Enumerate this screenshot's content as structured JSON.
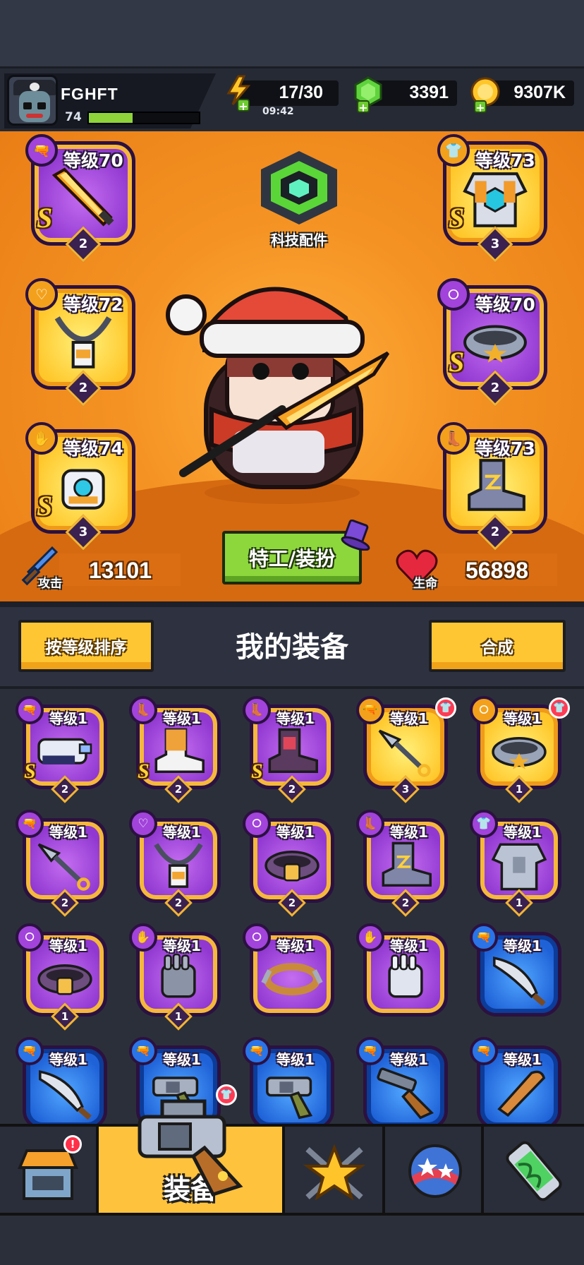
{
  "player": {
    "name": "FGHFT",
    "level": "74",
    "xp_fraction": 0.4
  },
  "resources": {
    "energy": {
      "value": "17/30",
      "timer": "09:42"
    },
    "gems": {
      "value": "3391"
    },
    "coins": {
      "value": "9307K"
    }
  },
  "hero": {
    "tech_parts_label": "科技配件",
    "costume_button": "特工/装扮",
    "attack": {
      "label": "攻击",
      "value": "13101"
    },
    "health": {
      "label": "生命",
      "value": "56898"
    },
    "equipped": {
      "weapon": {
        "level": "等级70",
        "stars": "2",
        "rank": "S",
        "rarity": "purple",
        "icon": "weapon-slot-icon"
      },
      "necklace": {
        "level": "等级72",
        "stars": "2",
        "rank": "",
        "rarity": "gold",
        "icon": "necklace-slot-icon"
      },
      "glove": {
        "level": "等级74",
        "stars": "3",
        "rank": "S",
        "rarity": "gold",
        "icon": "glove-slot-icon"
      },
      "armor": {
        "level": "等级73",
        "stars": "3",
        "rank": "S",
        "rarity": "gold",
        "icon": "armor-slot-icon"
      },
      "belt": {
        "level": "等级70",
        "stars": "2",
        "rank": "S",
        "rarity": "purple",
        "icon": "belt-slot-icon"
      },
      "boots": {
        "level": "等级73",
        "stars": "2",
        "rank": "",
        "rarity": "gold",
        "icon": "boots-slot-icon"
      }
    }
  },
  "inventory": {
    "sort_button": "按等级排序",
    "title": "我的装备",
    "merge_button": "合成",
    "items": [
      {
        "level": "等级1",
        "stars": "2",
        "rank": "S",
        "rarity": "purple",
        "type": "weapon",
        "item": "gun"
      },
      {
        "level": "等级1",
        "stars": "2",
        "rank": "S",
        "rarity": "purple",
        "type": "boots",
        "item": "boot"
      },
      {
        "level": "等级1",
        "stars": "2",
        "rank": "S",
        "rarity": "purple",
        "type": "boots",
        "item": "boot-dark"
      },
      {
        "level": "等级1",
        "stars": "3",
        "rank": "",
        "rarity": "gold",
        "type": "weapon",
        "item": "kunai",
        "new": true
      },
      {
        "level": "等级1",
        "stars": "1",
        "rank": "",
        "rarity": "gold",
        "type": "belt",
        "item": "belt",
        "new": true
      },
      {
        "level": "等级1",
        "stars": "2",
        "rank": "",
        "rarity": "purple",
        "type": "weapon",
        "item": "kunai"
      },
      {
        "level": "等级1",
        "stars": "2",
        "rank": "",
        "rarity": "purple",
        "type": "necklace",
        "item": "necklace"
      },
      {
        "level": "等级1",
        "stars": "2",
        "rank": "",
        "rarity": "purple",
        "type": "belt",
        "item": "belt-dark"
      },
      {
        "level": "等级1",
        "stars": "2",
        "rank": "",
        "rarity": "purple",
        "type": "boots",
        "item": "boot-purple"
      },
      {
        "level": "等级1",
        "stars": "1",
        "rank": "",
        "rarity": "purple",
        "type": "armor",
        "item": "armor"
      },
      {
        "level": "等级1",
        "stars": "1",
        "rank": "",
        "rarity": "purple",
        "type": "belt",
        "item": "belt-dark"
      },
      {
        "level": "等级1",
        "stars": "1",
        "rank": "",
        "rarity": "purple",
        "type": "glove",
        "item": "glove"
      },
      {
        "level": "等级1",
        "stars": "",
        "rank": "",
        "rarity": "purple",
        "type": "belt",
        "item": "belt-rope"
      },
      {
        "level": "等级1",
        "stars": "",
        "rank": "",
        "rarity": "purple",
        "type": "glove",
        "item": "glove-light"
      },
      {
        "level": "等级1",
        "stars": "",
        "rank": "",
        "rarity": "blue",
        "type": "weapon",
        "item": "machete"
      },
      {
        "level": "等级1",
        "stars": "",
        "rank": "",
        "rarity": "blue",
        "type": "weapon",
        "item": "machete"
      },
      {
        "level": "等级1",
        "stars": "",
        "rank": "",
        "rarity": "blue",
        "type": "weapon",
        "item": "revolver"
      },
      {
        "level": "等级1",
        "stars": "",
        "rank": "",
        "rarity": "blue",
        "type": "weapon",
        "item": "revolver"
      },
      {
        "level": "等级1",
        "stars": "",
        "rank": "",
        "rarity": "blue",
        "type": "weapon",
        "item": "shotgun"
      },
      {
        "level": "等级1",
        "stars": "",
        "rank": "",
        "rarity": "blue",
        "type": "weapon",
        "item": "bat"
      }
    ]
  },
  "nav": {
    "equipment_label": "装备",
    "shop_alert": "!",
    "tabs": [
      "shop-tab",
      "equipment-tab",
      "talent-tab",
      "badge-tab",
      "gene-tab"
    ]
  },
  "colors": {
    "purple": "#9138d1",
    "gold": "#ffc72a",
    "blue": "#1f62d8",
    "orange": "#f49223",
    "green": "#8dd73d"
  }
}
